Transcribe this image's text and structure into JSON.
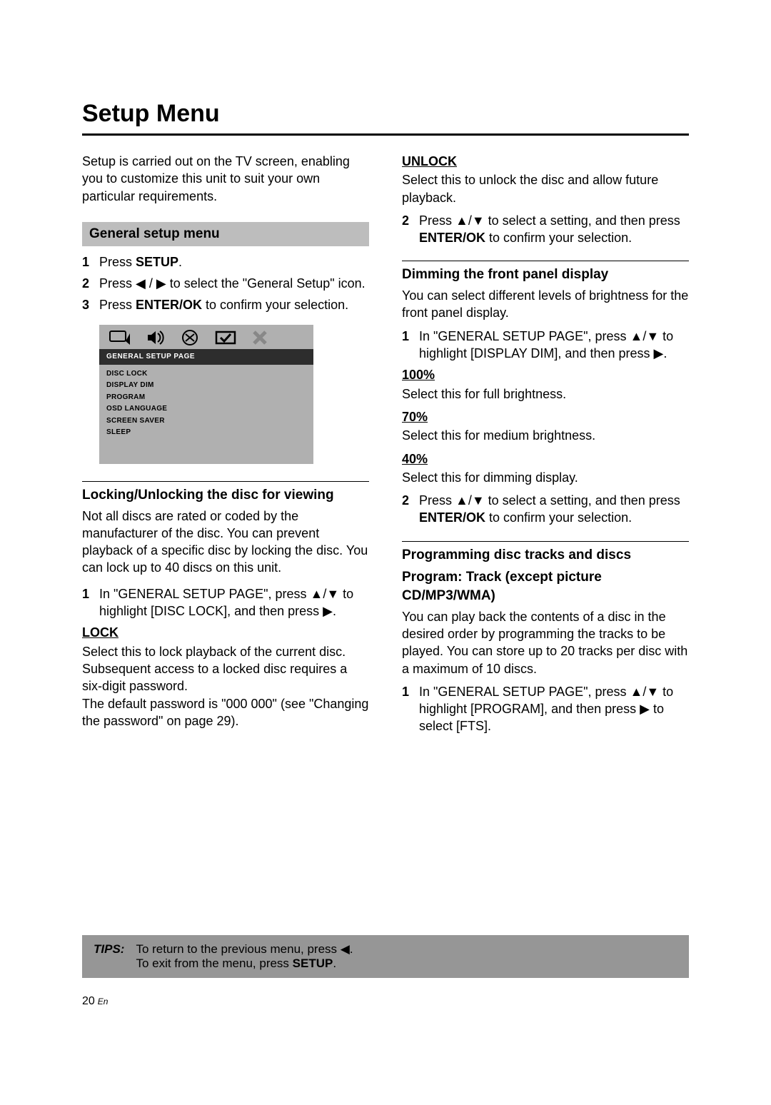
{
  "title": "Setup Menu",
  "intro": "Setup is carried out on the TV screen, enabling you to customize this unit to suit your own particular requirements.",
  "general_setup_heading": "General setup menu",
  "steps_general": {
    "s1_a": "Press ",
    "s1_b": "SETUP",
    "s1_c": ".",
    "s2_a": "Press ◀ / ▶ to select the \"General Setup\" icon.",
    "s3_a": "Press ",
    "s3_b": "ENTER/OK",
    "s3_c": " to confirm your selection."
  },
  "osd": {
    "bar": "GENERAL SETUP PAGE",
    "items": [
      "DISC LOCK",
      "DISPLAY DIM",
      "PROGRAM",
      "OSD LANGUAGE",
      "SCREEN SAVER",
      "SLEEP"
    ]
  },
  "lock_heading": "Locking/Unlocking the disc for viewing",
  "lock_para": "Not all discs are rated or coded by the manufacturer of the disc. You can prevent playback of a specific disc by locking the disc. You can lock up to 40 discs on this unit.",
  "lock_step1": "In \"GENERAL SETUP PAGE\", press ▲/▼ to highlight [DISC LOCK], and then press ▶.",
  "lock_label": "LOCK",
  "lock_desc1": "Select this to lock playback of the current disc. Subsequent access to a locked disc requires a six-digit password.",
  "lock_desc2": "The default password is \"000 000\" (see \"Changing the password\" on page 29).",
  "unlock_label": "UNLOCK",
  "unlock_desc": "Select this to unlock the disc and allow future playback.",
  "step_updown_a": "Press ▲/▼ to select a setting, and then press ",
  "step_updown_b": "ENTER/OK",
  "step_updown_c": " to confirm your selection.",
  "dim_heading": "Dimming the front panel display",
  "dim_para": "You can select different levels of brightness for the front panel display.",
  "dim_step1": "In \"GENERAL SETUP PAGE\", press ▲/▼ to highlight [DISPLAY DIM], and then press ▶.",
  "pct100_label": "100%",
  "pct100_desc": "Select this for full brightness.",
  "pct70_label": "70%",
  "pct70_desc": "Select this for medium brightness.",
  "pct40_label": "40%",
  "pct40_desc": "Select this for dimming display.",
  "prog_heading": "Programming disc tracks and discs",
  "prog_sub": "Program: Track (except picture CD/MP3/WMA)",
  "prog_para": "You can play back the contents of a disc in the desired order by programming the tracks to be played. You can store up to 20 tracks per disc with a maximum of 10 discs.",
  "prog_step1": "In \"GENERAL SETUP PAGE\", press ▲/▼ to highlight [PROGRAM], and then press ▶ to select [FTS].",
  "tips_label": "TIPS:",
  "tips_line1": "To return to the previous menu, press ◀.",
  "tips_line2_a": "To exit from the menu, press ",
  "tips_line2_b": "SETUP",
  "tips_line2_c": ".",
  "page_num": "20",
  "page_lang": "En"
}
